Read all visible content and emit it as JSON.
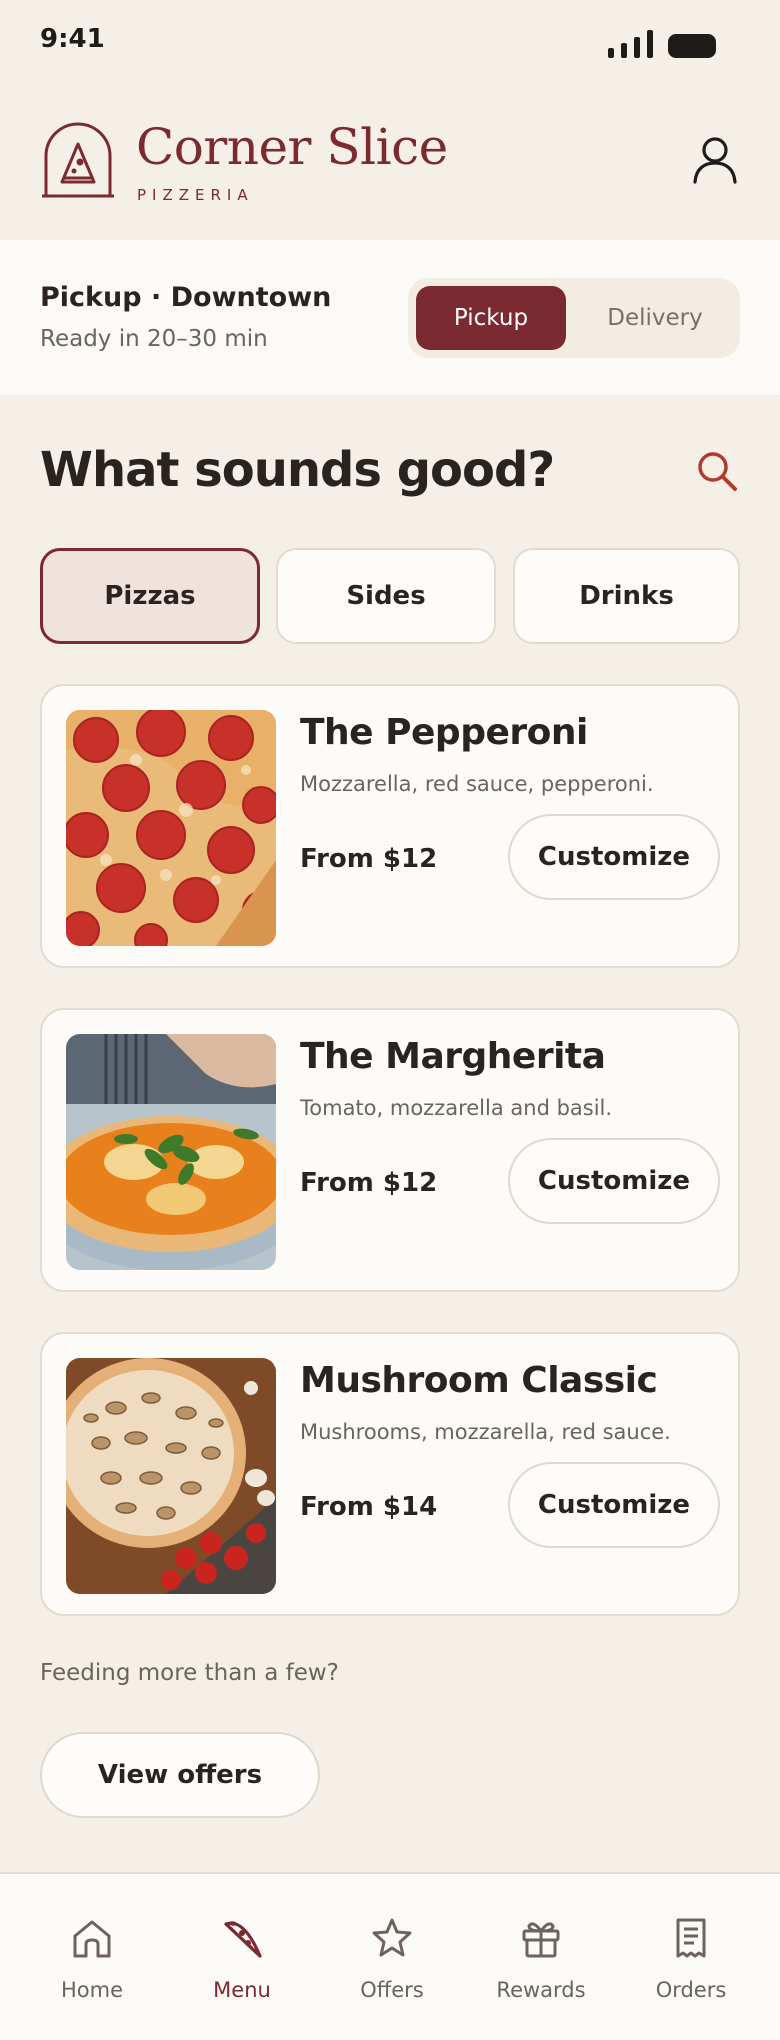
{
  "status_bar": {
    "time": "9:41"
  },
  "brand": {
    "name": "Corner Slice",
    "subtitle": "PIZZERIA",
    "color": "#7b2a31"
  },
  "order_mode": {
    "title": "Pickup · Downtown",
    "subtitle": "Ready in 20–30 min",
    "options": [
      "Pickup",
      "Delivery"
    ],
    "selected": "Pickup"
  },
  "menu": {
    "heading": "What sounds good?",
    "tabs": [
      "Pizzas",
      "Sides",
      "Drinks"
    ],
    "selected_tab": "Pizzas",
    "items": [
      {
        "name": "The Pepperoni",
        "description": "Mozzarella, red sauce, pepperoni.",
        "price": "From $12",
        "action": "Customize",
        "image": "pepperoni-pizza-photo"
      },
      {
        "name": "The Margherita",
        "description": "Tomato, mozzarella and basil.",
        "price": "From $12",
        "action": "Customize",
        "image": "margherita-pizza-photo"
      },
      {
        "name": "Mushroom Classic",
        "description": "Mushrooms, mozzarella, red sauce.",
        "price": "From $14",
        "action": "Customize",
        "image": "mushroom-pizza-photo"
      }
    ]
  },
  "offers": {
    "prompt": "Feeding more than a few?",
    "button": "View offers"
  },
  "nav": {
    "items": [
      {
        "label": "Home",
        "icon": "home-icon"
      },
      {
        "label": "Menu",
        "icon": "pizza-slice-icon"
      },
      {
        "label": "Offers",
        "icon": "star-icon"
      },
      {
        "label": "Rewards",
        "icon": "gift-icon"
      },
      {
        "label": "Orders",
        "icon": "receipt-icon"
      }
    ],
    "active": "Menu"
  },
  "colors": {
    "accent": "#7b2a31",
    "background": "#f4efe7",
    "card": "#fdfbf7",
    "search_icon": "#b33a2a"
  }
}
